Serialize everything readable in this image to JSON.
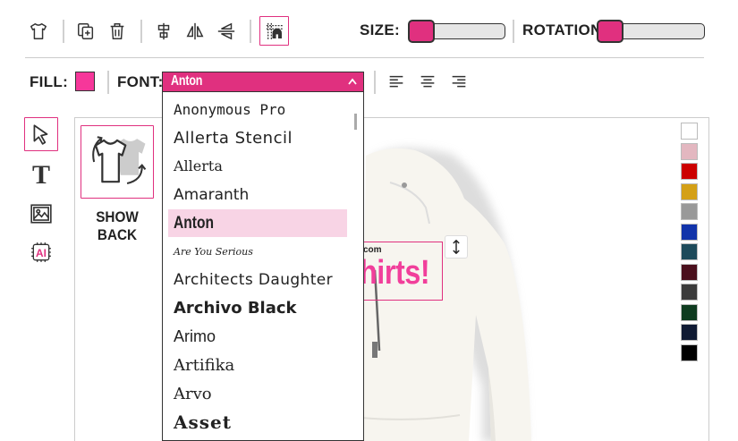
{
  "toolbar": {
    "size_label": "SIZE:",
    "size_value": 0.0,
    "rotation_label": "ROTATION:",
    "rotation_value": 0.0,
    "icons": [
      "tshirt-icon",
      "duplicate-icon",
      "trash-icon",
      "align-center-vertical-icon",
      "flip-horizontal-icon",
      "flip-vertical-icon",
      "grid-snap-icon"
    ]
  },
  "format_bar": {
    "fill_label": "FILL:",
    "fill_color": "#f6379a",
    "font_label": "FONT:",
    "font_selected": "Anton",
    "align_icons": [
      "align-left-icon",
      "align-center-icon",
      "align-right-icon"
    ]
  },
  "left_tools": [
    "select-arrow-icon",
    "text-tool-icon",
    "image-tool-icon",
    "ai-tool-icon"
  ],
  "show_back": {
    "line1": "SHOW",
    "line2": "BACK"
  },
  "font_list": [
    "Anonymous Pro",
    "Allerta Stencil",
    "Allerta",
    "Amaranth",
    "Anton",
    "Are You Serious",
    "Architects Daughter",
    "Archivo Black",
    "Arimo",
    "Artifika",
    "Arvo",
    "Asset"
  ],
  "canvas_text": {
    "small": "com",
    "big": "hirts!",
    "color": "#f13f9b"
  },
  "swatches": [
    "#ffffff",
    "#e3b7c0",
    "#cc0000",
    "#d4a017",
    "#999999",
    "#1133aa",
    "#1d4a5a",
    "#4a0f1c",
    "#3b3b3b",
    "#0e3b1f",
    "#0f1a33",
    "#000000"
  ],
  "accent": "#e0307f"
}
